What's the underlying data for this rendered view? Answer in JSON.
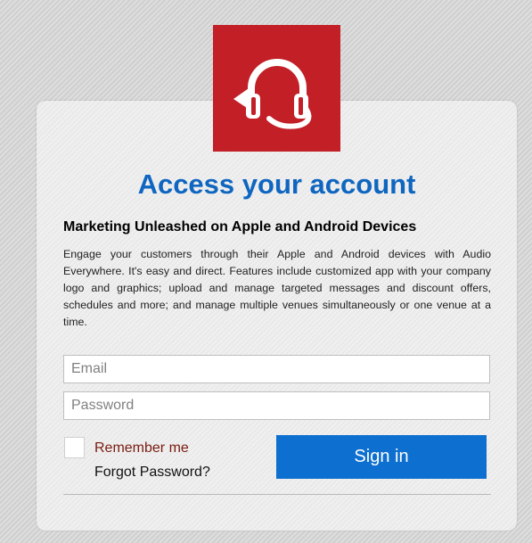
{
  "page": {
    "title": "Access your account",
    "subtitle": "Marketing Unleashed on Apple and Android Devices",
    "description": "Engage your customers through their Apple and Android devices with Audio Everywhere. It's easy and direct. Features include customized app with your company logo and graphics; upload and manage targeted messages and discount offers, schedules and more; and manage multiple venues simultaneously or one venue at a time."
  },
  "logo": {
    "icon": "headphones-arrow-icon",
    "background": "#c21f26"
  },
  "form": {
    "email_placeholder": "Email",
    "email_value": "",
    "password_placeholder": "Password",
    "password_value": "",
    "remember_label": "Remember me",
    "remember_checked": false,
    "forgot_label": "Forgot Password?",
    "signin_label": "Sign in"
  },
  "colors": {
    "accent": "#0f66c0",
    "button": "#0d6fcf",
    "brand": "#c21f26",
    "remember_text": "#7a1c10"
  }
}
